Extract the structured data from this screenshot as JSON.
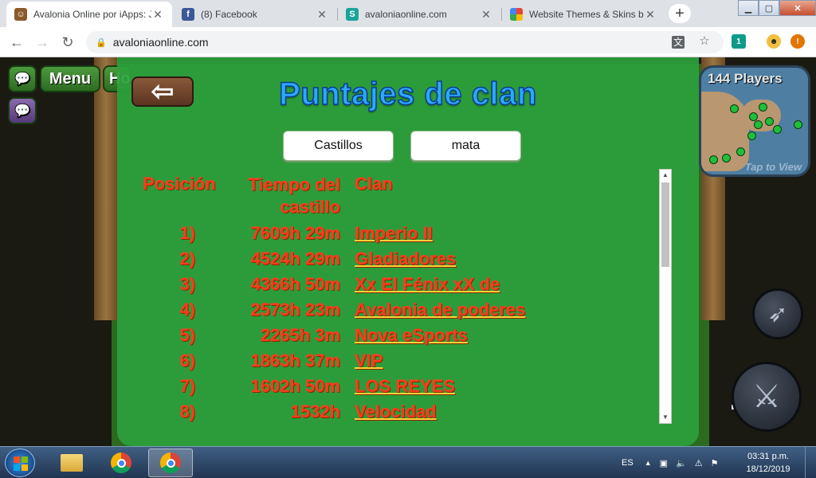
{
  "browser": {
    "tabs": [
      {
        "title": "Avalonia Online por iApps: Ju",
        "favicon": "game-favicon",
        "active": true
      },
      {
        "title": "(8) Facebook",
        "favicon": "facebook-favicon",
        "active": false
      },
      {
        "title": "avaloniaonline.com",
        "favicon": "s-favicon",
        "active": false
      },
      {
        "title": "Website Themes & Skins b",
        "favicon": "themes-favicon",
        "active": false
      }
    ],
    "new_tab_symbol": "+",
    "url": "avaloniaonline.com",
    "extension_badge": "1"
  },
  "game": {
    "menu_label": "Menu",
    "home_label": "Ho",
    "players_label": "144 Players",
    "view_label": "Tap to View"
  },
  "panel": {
    "title": "Puntajes de clan",
    "back_symbol": "⇦",
    "tabs": [
      "Castillos",
      "mata"
    ],
    "headers": {
      "position": "Posición",
      "time_line1": "Tiempo del",
      "time_line2": "castillo",
      "clan": "Clan"
    },
    "rows": [
      {
        "pos": "1)",
        "time": "7609h 29m",
        "clan": "Imperio II"
      },
      {
        "pos": "2)",
        "time": "4524h 29m",
        "clan": "Gladiadores"
      },
      {
        "pos": "3)",
        "time": "4366h 50m",
        "clan": "Xx El Fénix xX de"
      },
      {
        "pos": "4)",
        "time": "2573h 23m",
        "clan": "Avalonia de poderes"
      },
      {
        "pos": "5)",
        "time": "2265h 3m",
        "clan": "Nova eSports"
      },
      {
        "pos": "6)",
        "time": "1863h 37m",
        "clan": "VIP"
      },
      {
        "pos": "7)",
        "time": "1602h 50m",
        "clan": "LOS REYES"
      },
      {
        "pos": "8)",
        "time": "1532h",
        "clan": "Velocidad"
      }
    ]
  },
  "taskbar": {
    "language": "ES",
    "time": "03:31 p.m.",
    "date": "18/12/2019"
  },
  "colors": {
    "panel_green": "#2ca03c",
    "title_blue": "#2ea7ff",
    "score_red": "#ff3b1c",
    "link_underline": "#ffd23a"
  }
}
